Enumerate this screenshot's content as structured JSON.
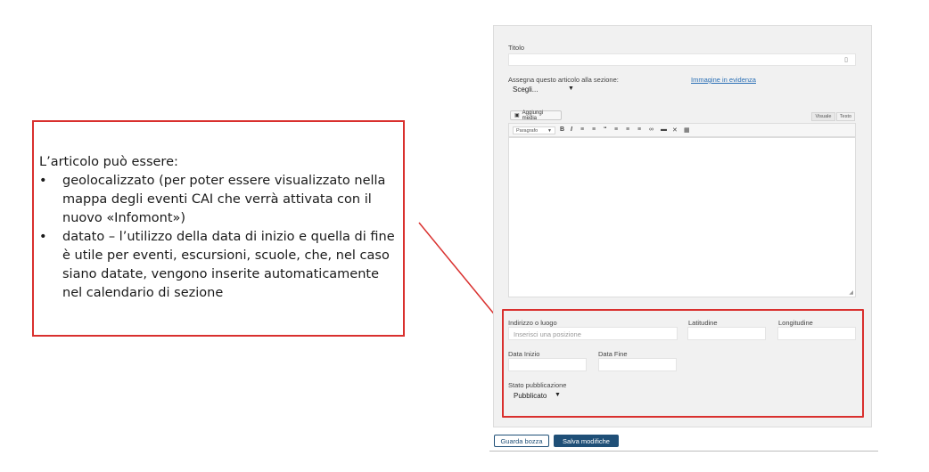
{
  "callout": {
    "intro": "L’articolo può essere:",
    "bullets": [
      "geolocalizzato (per poter essere visualizzato nella mappa degli eventi CAI che verrà attivata con il nuovo «Infomont»)",
      "datato – l’utilizzo della data di inizio e quella di fine è utile per eventi, escursioni, scuole, che, nel caso siano datate, vengono inserite automaticamente nel calendario di sezione"
    ]
  },
  "form": {
    "title_label": "Titolo",
    "section_label": "Assegna questo articolo alla sezione:",
    "section_value": "Scegli...",
    "featured_image_link": "Immagine in evidenza",
    "add_media_label": "Aggiungi media",
    "tab_visual": "Visuale",
    "tab_text": "Testo",
    "paragraph_select": "Paragrafo",
    "toolbar_icons": [
      "bold-icon",
      "italic-icon",
      "bullet-list-icon",
      "numbered-list-icon",
      "quote-icon",
      "align-left-icon",
      "align-center-icon",
      "align-right-icon",
      "link-icon",
      "hr-icon",
      "fullscreen-icon",
      "kitchen-sink-icon"
    ],
    "address_label": "Indirizzo o luogo",
    "address_placeholder": "Inserisci una posizione",
    "latitude_label": "Latitudine",
    "longitude_label": "Longitudine",
    "start_date_label": "Data Inizio",
    "end_date_label": "Data Fine",
    "status_label": "Stato pubblicazione",
    "status_value": "Pubblicato"
  },
  "actions": {
    "draft_label": "Guarda bozza",
    "save_label": "Salva modifiche"
  },
  "colors": {
    "accent_red": "#d9302e",
    "primary_blue": "#1f4f77",
    "link_blue": "#2a6fb5"
  }
}
